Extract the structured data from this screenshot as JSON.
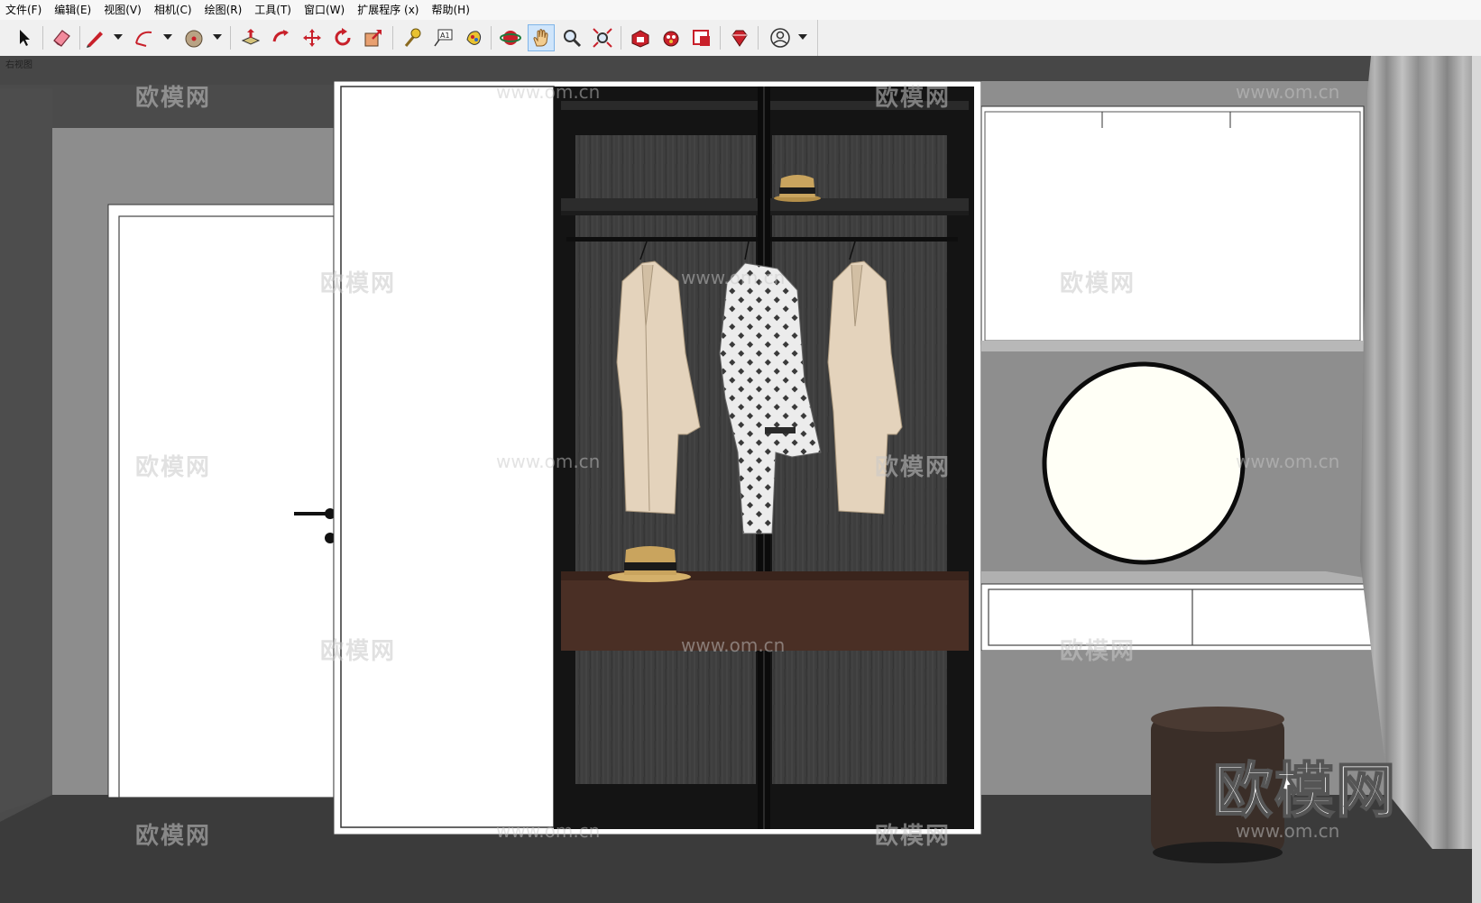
{
  "menu": [
    {
      "label": "文件(F)"
    },
    {
      "label": "编辑(E)"
    },
    {
      "label": "视图(V)"
    },
    {
      "label": "相机(C)"
    },
    {
      "label": "绘图(R)"
    },
    {
      "label": "工具(T)"
    },
    {
      "label": "窗口(W)"
    },
    {
      "label": "扩展程序 (x)"
    },
    {
      "label": "帮助(H)"
    }
  ],
  "toolbar": {
    "tools": [
      {
        "icon": "select-arrow-icon"
      },
      {
        "icon": "eraser-icon"
      },
      {
        "icon": "pencil-line-icon"
      },
      {
        "icon": "arc-icon"
      },
      {
        "icon": "paint-bucket-icon"
      },
      {
        "icon": "push-pull-icon"
      },
      {
        "icon": "follow-me-icon"
      },
      {
        "icon": "move-icon"
      },
      {
        "icon": "rotate-icon"
      },
      {
        "icon": "scale-icon"
      },
      {
        "icon": "tape-measure-icon"
      },
      {
        "icon": "text-label-icon"
      },
      {
        "icon": "paint-icon"
      },
      {
        "icon": "orbit-icon"
      },
      {
        "icon": "pan-hand-icon"
      },
      {
        "icon": "zoom-icon"
      },
      {
        "icon": "zoom-extents-icon"
      },
      {
        "icon": "3d-warehouse-icon"
      },
      {
        "icon": "extension-warehouse-icon"
      },
      {
        "icon": "layout-icon"
      },
      {
        "icon": "ruby-console-icon"
      },
      {
        "icon": "account-icon"
      }
    ],
    "active_tool": "pan-hand-icon"
  },
  "viewport": {
    "scene_label": "右视图",
    "watermark_text": "欧模网",
    "watermark_url": "www.om.cn",
    "watermark_logo": "欧模网"
  },
  "colors": {
    "wall": "#4a4a4a",
    "wall_light": "#8e8e8e",
    "wardrobe_frame": "#111111",
    "wood_dark": "#3f3f3f",
    "drawer": "#4a2f25",
    "coat": "#e4d3bc",
    "curtain": "#9a9a9a"
  }
}
